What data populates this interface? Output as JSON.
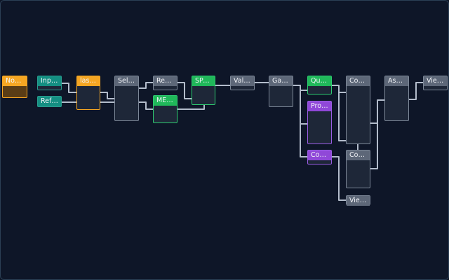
{
  "nodes": [
    {
      "key": "notes",
      "label": "Notes"
    },
    {
      "key": "input",
      "label": "Input..."
    },
    {
      "key": "refer",
      "label": "Refer..."
    },
    {
      "key": "lastp",
      "label": "lastp..."
    },
    {
      "key": "selec",
      "label": "Selec..."
    },
    {
      "key": "retry",
      "label": "Retry..."
    },
    {
      "key": "megah",
      "label": "MEGAH..."
    },
    {
      "key": "spade",
      "label": "SPAde..."
    },
    {
      "key": "valid",
      "label": "Valid..."
    },
    {
      "key": "gate",
      "label": "Gate ..."
    },
    {
      "key": "quast",
      "label": "Quast..."
    },
    {
      "key": "prokk",
      "label": "Prokk..."
    },
    {
      "key": "conti_small",
      "label": "Conti..."
    },
    {
      "key": "conti_a",
      "label": "Conti..."
    },
    {
      "key": "conti_b",
      "label": "Conti..."
    },
    {
      "key": "view_b",
      "label": "View..."
    },
    {
      "key": "assem",
      "label": "Assem..."
    },
    {
      "key": "view_end",
      "label": "View..."
    }
  ],
  "colors": {
    "wire": "#b3bccb",
    "default": "#5d6778",
    "orange": "#f5a623",
    "teal": "#148f82",
    "green": "#20b85a",
    "purple": "#9048d8"
  }
}
